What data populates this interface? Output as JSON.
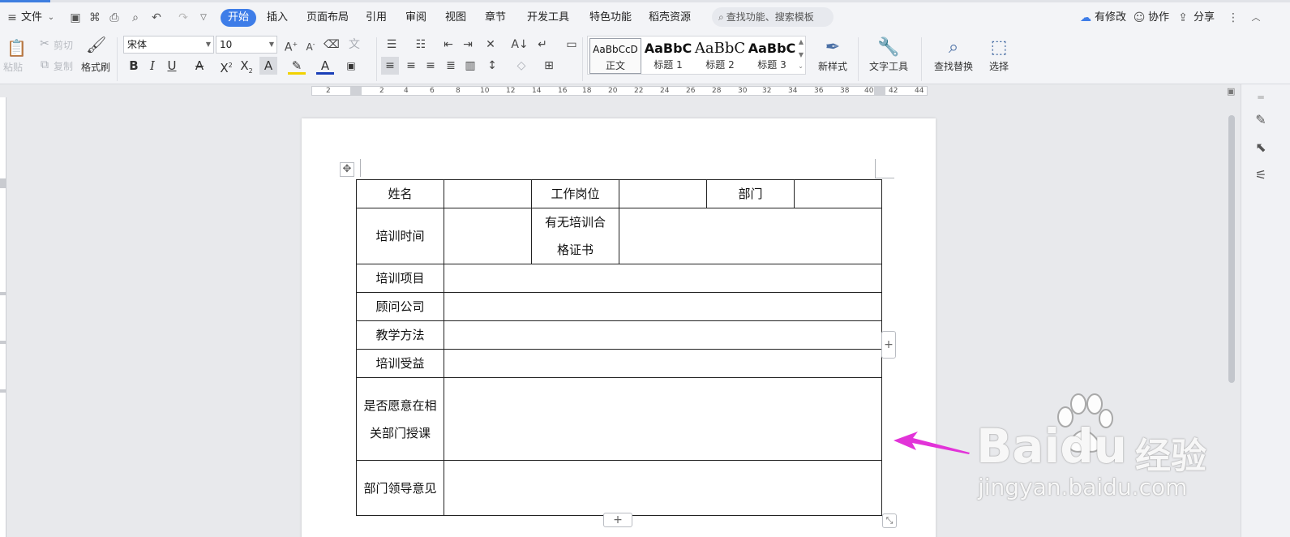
{
  "menubar": {
    "file": "文件",
    "tabs": [
      "开始",
      "插入",
      "页面布局",
      "引用",
      "审阅",
      "视图",
      "章节",
      "开发工具",
      "特色功能",
      "稻壳资源"
    ],
    "search_placeholder": "查找功能、搜索模板",
    "right": {
      "modified": "有修改",
      "collab": "协作",
      "share": "分享"
    }
  },
  "ribbon": {
    "clipboard": {
      "paste": "粘贴",
      "cut": "剪切",
      "copy": "复制",
      "format_painter": "格式刷"
    },
    "font": {
      "name": "宋体",
      "size": "10"
    },
    "styles": [
      {
        "preview": "AaBbCcD",
        "caption": "正文"
      },
      {
        "preview": "AaBbC",
        "caption": "标题 1"
      },
      {
        "preview": "AaBbC",
        "caption": "标题 2"
      },
      {
        "preview": "AaBbC",
        "caption": "标题 3"
      }
    ],
    "new_style": "新样式",
    "text_tools": "文字工具",
    "find_replace": "查找替换",
    "select": "选择"
  },
  "ruler": {
    "labels": [
      "2",
      "2",
      "4",
      "6",
      "8",
      "10",
      "12",
      "14",
      "16",
      "18",
      "20",
      "22",
      "24",
      "26",
      "28",
      "30",
      "32",
      "34",
      "36",
      "38",
      "40",
      "42",
      "44"
    ]
  },
  "table": {
    "row1": {
      "name_label": "姓名",
      "name_value": "",
      "position_label": "工作岗位",
      "position_value": "",
      "dept_label": "部门",
      "dept_value": ""
    },
    "row2": {
      "label": "培训时间",
      "value": "",
      "cert_label": "有无培训合格证书",
      "cert_value": ""
    },
    "row3": {
      "label": "培训项目",
      "value": ""
    },
    "row4": {
      "label": "顾问公司",
      "value": ""
    },
    "row5": {
      "label": "教学方法",
      "value": ""
    },
    "row6": {
      "label": "培训受益",
      "value": ""
    },
    "row7": {
      "label": "是否愿意在相关部门授课",
      "value": ""
    },
    "row8": {
      "label": "部门领导意见",
      "value": ""
    }
  },
  "watermark": {
    "brand": "Baidu",
    "cn": "经验",
    "url": "jingyan.baidu.com"
  },
  "colors": {
    "accent": "#3e7de8",
    "arrow": "#e233d8"
  }
}
